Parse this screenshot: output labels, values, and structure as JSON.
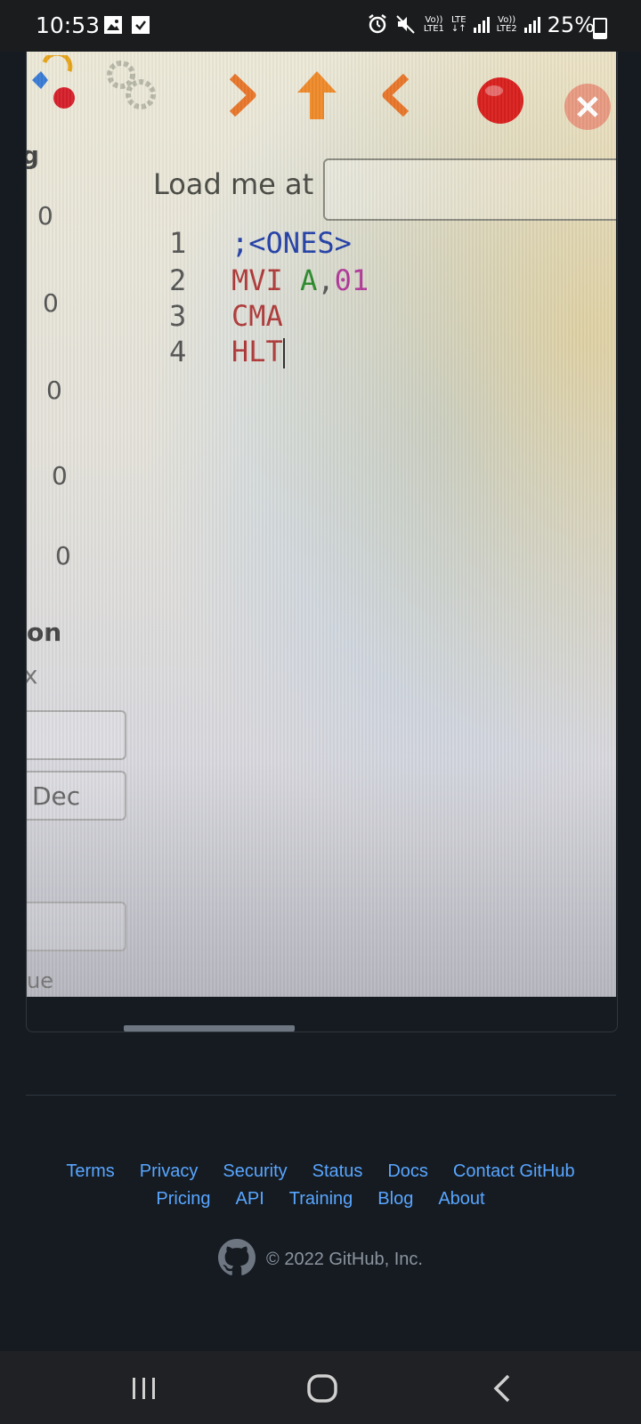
{
  "status_bar": {
    "time": "10:53",
    "net1_top": "Vo))",
    "net1_bottom": "LTE1",
    "lte_label": "LTE",
    "net2_top": "Vo))",
    "net2_bottom": "LTE2",
    "battery": "25%"
  },
  "photo": {
    "load_label": "Load me at",
    "code": [
      {
        "num": "1",
        "text": ";<ONES>"
      },
      {
        "num": "2",
        "op": "MVI",
        "reg": "A",
        "sep": ",",
        "val": "01"
      },
      {
        "num": "3",
        "op": "CMA"
      },
      {
        "num": "4",
        "op": "HLT"
      }
    ],
    "side_values": [
      "0",
      "0",
      "0",
      "0",
      "0"
    ],
    "side_on": "on",
    "side_x": "x",
    "side_dec": "Dec",
    "side_ue": "ue",
    "side_g": "g"
  },
  "footer": {
    "row1": [
      "Terms",
      "Privacy",
      "Security",
      "Status",
      "Docs",
      "Contact GitHub"
    ],
    "row2": [
      "Pricing",
      "API",
      "Training",
      "Blog",
      "About"
    ],
    "copyright": "© 2022 GitHub, Inc."
  },
  "colors": {
    "background": "#161b22",
    "link": "#58a6ff",
    "muted": "#8b949e"
  }
}
